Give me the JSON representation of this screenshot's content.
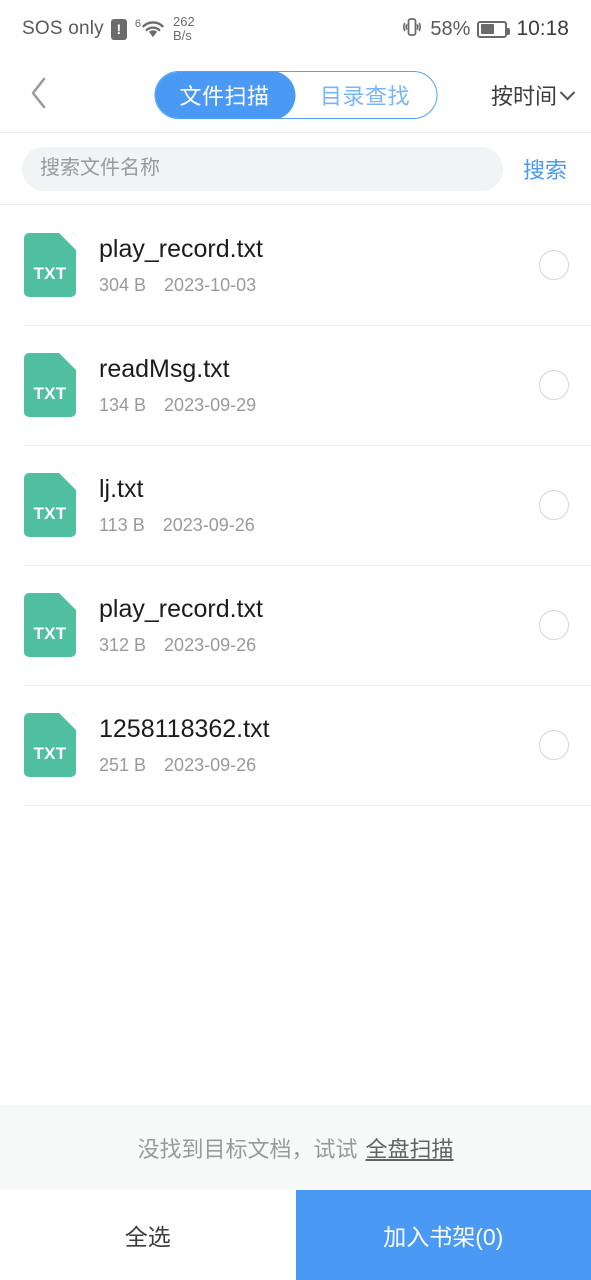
{
  "status_bar": {
    "carrier": "SOS only",
    "alert_icon": "alert-exclamation-icon",
    "wifi_icon": "wifi-icon",
    "wifi_generation": "6",
    "network_speed_value": "262",
    "network_speed_unit": "B/s",
    "vibrate_icon": "vibrate-icon",
    "battery_percent": "58%",
    "battery_level": 58,
    "battery_icon": "battery-icon",
    "clock": "10:18"
  },
  "top_nav": {
    "back_icon": "back-chevron-icon",
    "tabs": [
      {
        "label": "文件扫描",
        "active": true
      },
      {
        "label": "目录查找",
        "active": false
      }
    ],
    "sort": {
      "label": "按时间",
      "icon": "chevron-down-icon"
    }
  },
  "search": {
    "placeholder": "搜索文件名称",
    "value": "",
    "button_label": "搜索"
  },
  "files": [
    {
      "name": "play_record.txt",
      "ext": "TXT",
      "size": "304 B",
      "date": "2023-10-03",
      "selected": false
    },
    {
      "name": "readMsg.txt",
      "ext": "TXT",
      "size": "134 B",
      "date": "2023-09-29",
      "selected": false
    },
    {
      "name": "lj.txt",
      "ext": "TXT",
      "size": "113 B",
      "date": "2023-09-26",
      "selected": false
    },
    {
      "name": "play_record.txt",
      "ext": "TXT",
      "size": "312 B",
      "date": "2023-09-26",
      "selected": false
    },
    {
      "name": "1258118362.txt",
      "ext": "TXT",
      "size": "251 B",
      "date": "2023-09-26",
      "selected": false
    }
  ],
  "hint": {
    "text": "没找到目标文档，试试",
    "link_label": "全盘扫描"
  },
  "actions": {
    "select_all_label": "全选",
    "add_to_shelf_label": "加入书架(0)",
    "selected_count": 0
  },
  "colors": {
    "accent_blue": "#4a9af5",
    "file_icon_teal": "#4fbfa0",
    "divider": "#ededed",
    "hint_bg": "#f7f8f8",
    "search_bg": "#f2f3f5"
  }
}
